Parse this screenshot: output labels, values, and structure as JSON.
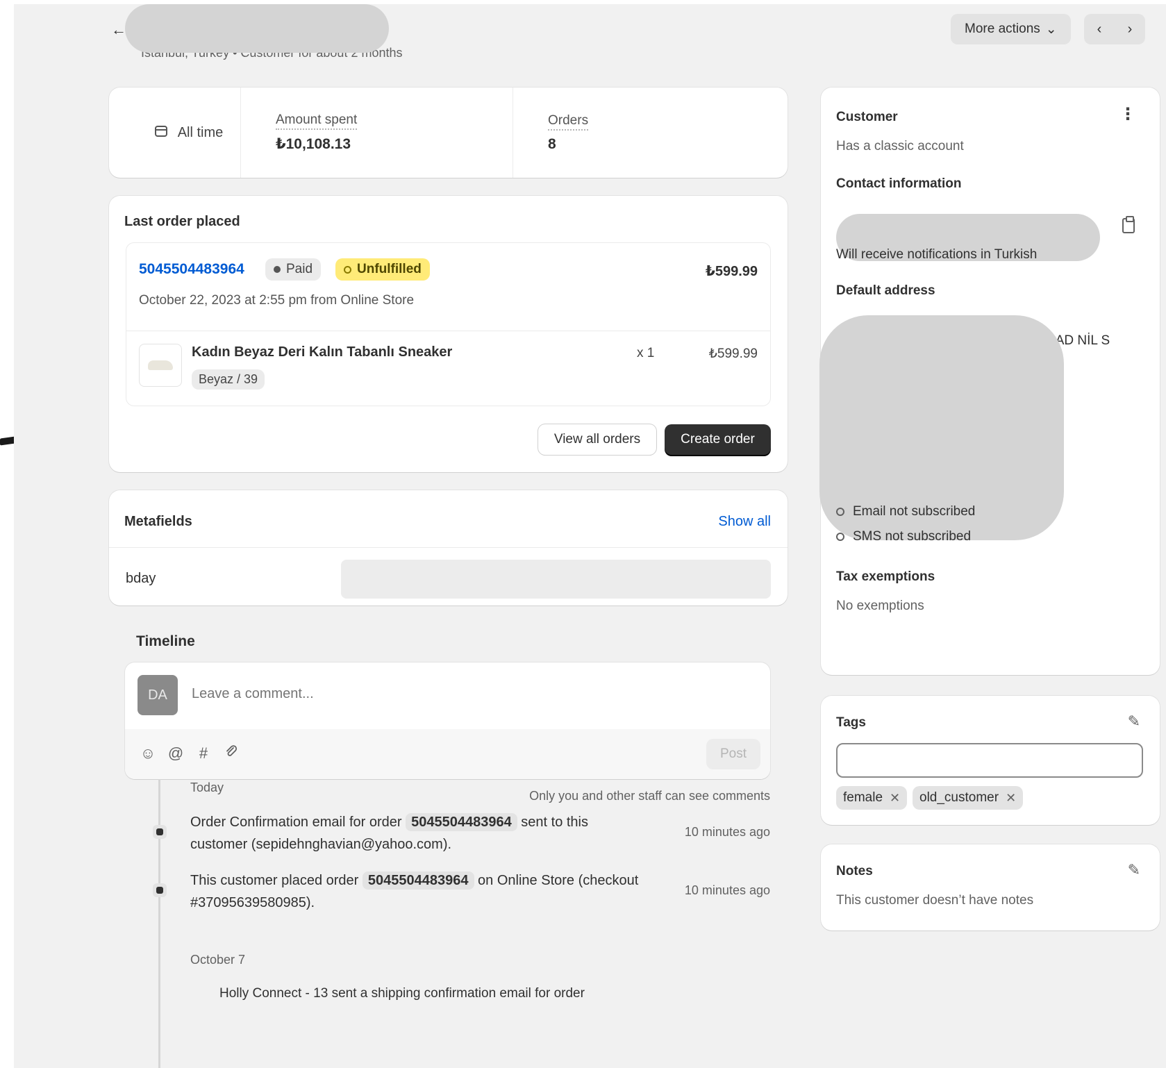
{
  "header": {
    "back_icon": "arrow-left-icon",
    "subtitle": "İstanbul, Turkey • Customer for about 2 months",
    "more_actions": "More actions",
    "prev_icon": "chevron-left-icon",
    "next_icon": "chevron-right-icon"
  },
  "stats": {
    "period": "All time",
    "amount_label": "Amount spent",
    "amount_value": "₺10,108.13",
    "orders_label": "Orders",
    "orders_value": "8"
  },
  "last_order": {
    "title": "Last order placed",
    "order_number": "5045504483964",
    "paid_badge": "Paid",
    "fulfillment_badge": "Unfulfilled",
    "total": "₺599.99",
    "meta": "October 22, 2023 at 2:55 pm from Online Store",
    "product_name": "Kadın Beyaz Deri Kalın Tabanlı Sneaker",
    "variant": "Beyaz / 39",
    "quantity": "x 1",
    "line_price": "₺599.99",
    "view_all": "View all orders",
    "create": "Create order"
  },
  "metafields": {
    "title": "Metafields",
    "show_all": "Show all",
    "field_label": "bday"
  },
  "timeline": {
    "title": "Timeline",
    "avatar_initials": "DA",
    "comment_placeholder": "Leave a comment...",
    "post": "Post",
    "staff_note": "Only you and other staff can see comments",
    "groups": [
      {
        "date": "Today"
      },
      {
        "date": "October 7"
      }
    ],
    "events": [
      {
        "pre": "Order Confirmation email for order ",
        "chip": "5045504483964",
        "post": " sent to this customer (sepidehnghavian@yahoo.com).",
        "time": "10 minutes ago"
      },
      {
        "pre": "This customer placed order ",
        "chip": "5045504483964",
        "post": " on Online Store (checkout #37095639580985).",
        "time": "10 minutes ago"
      }
    ],
    "cut_text": "Holly Connect - 13 sent a shipping confirmation email for order"
  },
  "customer": {
    "title": "Customer",
    "account": "Has a classic account",
    "contact_title": "Contact information",
    "notifications": "Will receive notifications in Turkish",
    "address_title": "Default address",
    "address_fragment": "CAD NİL S",
    "email_status": "Email not subscribed",
    "sms_status": "SMS not subscribed",
    "tax_title": "Tax exemptions",
    "tax_value": "No exemptions"
  },
  "tags": {
    "title": "Tags",
    "items": [
      "female",
      "old_customer"
    ]
  },
  "notes": {
    "title": "Notes",
    "empty": "This customer doesn’t have notes"
  }
}
